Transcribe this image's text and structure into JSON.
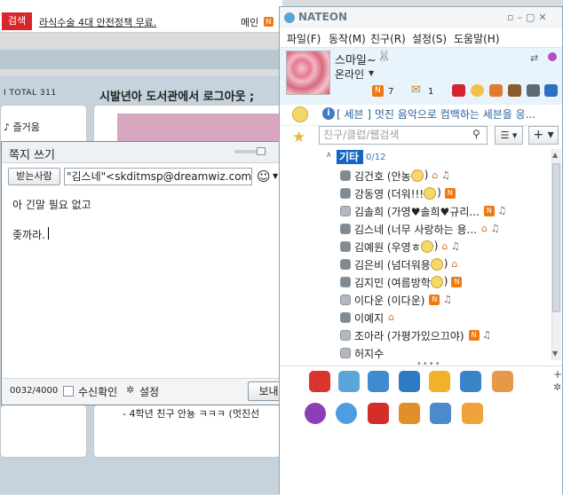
{
  "browser": {
    "search_label": "검색",
    "news_link": "라식수술 4대 안전정책 무료.",
    "main_label": "메인",
    "main_badge": "N",
    "total_label": "I TOTAL 311",
    "favorites": "♪ 즐거움",
    "post_title": "시발년아 도서관에서 로그아웃 ;",
    "friend_post": "- 4학년 친구 안뇽 ㅋㅋㅋ (멋진선"
  },
  "memo": {
    "title": "쪽지 쓰기",
    "to_button": "받는사람",
    "to_value": "\"김스네\"<skditmsp@dreamwiz.com>;",
    "body_line1": "아 긴말 필요 없고",
    "body_line2": "좆까라.",
    "char_count": "0032/4000",
    "receipt_label": "수신확인",
    "setting_label": "설정",
    "send_button": "보내기"
  },
  "nateon": {
    "logo": "NATEON",
    "menu": [
      "파일(F)",
      "동작(M)",
      "친구(R)",
      "설정(S)",
      "도움말(H)"
    ],
    "profile": {
      "nickname": "스마일~",
      "status": "온라인",
      "new_count": "7",
      "buddy_count": "1"
    },
    "message_bar": "[ 세븐 ] 멋진 음악으로 컴백하는 세븐을 응...",
    "search_placeholder": "친구/클럽/웹검색",
    "group": {
      "name": "기타",
      "count": "0/12"
    },
    "friends": [
      {
        "name": "김건호 (안농",
        "tail": ")",
        "emoji": true,
        "badges": "home music"
      },
      {
        "name": "강동영 (더워!!!",
        "tail": ")",
        "emoji": true,
        "badges": "n"
      },
      {
        "name": "김솔희 (가영♥솔희♥규리...",
        "tail": "",
        "emoji": false,
        "badges": "n music"
      },
      {
        "name": "김스네 (너무 사랑하는 용...",
        "tail": "",
        "emoji": false,
        "badges": "home music"
      },
      {
        "name": "김예원 (우영ㅎ",
        "tail": ")",
        "emoji": true,
        "badges": "home music"
      },
      {
        "name": "김은비 (넘더워용",
        "tail": ")",
        "emoji": true,
        "badges": "home"
      },
      {
        "name": "김지민 (여름방학",
        "tail": ")",
        "emoji": true,
        "badges": "n"
      },
      {
        "name": "이다운 (이다운)",
        "tail": "",
        "emoji": false,
        "badges": "n music"
      },
      {
        "name": "이예지",
        "tail": "",
        "emoji": false,
        "badges": "home"
      },
      {
        "name": "조아라 (가평가있으끄야)",
        "tail": "",
        "emoji": false,
        "badges": "n music"
      },
      {
        "name": "허지수",
        "tail": "",
        "emoji": false,
        "badges": ""
      }
    ]
  },
  "colors": {
    "accent": "#1466c2",
    "badge_orange": "#f07a12",
    "search_red": "#d8262c"
  }
}
